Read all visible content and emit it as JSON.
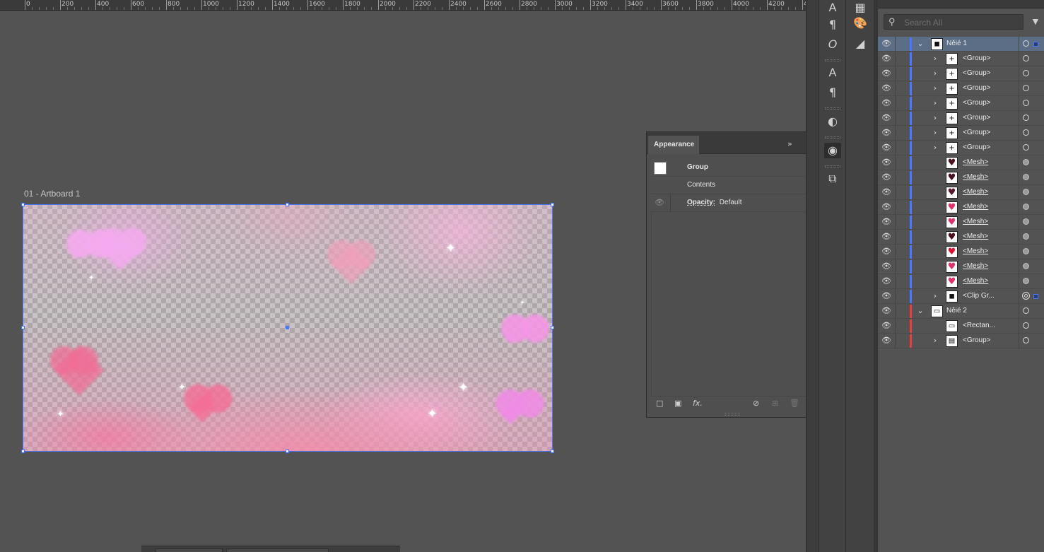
{
  "ruler": {
    "labels": [
      "0",
      "200",
      "400",
      "600",
      "800",
      "1000",
      "1200",
      "1400",
      "1600",
      "1800",
      "2000",
      "2200",
      "2400",
      "2600",
      "2800",
      "3000",
      "3200",
      "3400",
      "3600",
      "3800",
      "4000",
      "4200",
      "4"
    ]
  },
  "canvas": {
    "artboard_label": "01 - Artboard 1"
  },
  "appearance": {
    "tab_label": "Appearance",
    "collapse_glyph": "»",
    "menu_glyph": "≡",
    "rows": {
      "type_label": "Group",
      "contents_label": "Contents",
      "opacity_label": "Opacity:",
      "opacity_value": "Default"
    },
    "footer": {
      "new_stroke": "□",
      "new_fill": "▣",
      "fx": "fx.",
      "clear": "⊘",
      "duplicate": "⊞",
      "delete": "🗑"
    }
  },
  "layers": {
    "search_placeholder": "Search All",
    "rows": [
      {
        "name": "Něié 1",
        "level": 0,
        "expanded": true,
        "thumb": "◼",
        "color": "#4a78ff",
        "selected": true,
        "target": "empty",
        "selsq": true
      },
      {
        "name": "<Group>",
        "level": 1,
        "expandable": true,
        "thumb": "+",
        "color": "#4a78ff",
        "target": "empty"
      },
      {
        "name": "<Group>",
        "level": 1,
        "expandable": true,
        "thumb": "+",
        "color": "#4a78ff",
        "target": "empty"
      },
      {
        "name": "<Group>",
        "level": 1,
        "expandable": true,
        "thumb": "+",
        "color": "#4a78ff",
        "target": "empty"
      },
      {
        "name": "<Group>",
        "level": 1,
        "expandable": true,
        "thumb": "+",
        "color": "#4a78ff",
        "target": "empty"
      },
      {
        "name": "<Group>",
        "level": 1,
        "expandable": true,
        "thumb": "+",
        "color": "#4a78ff",
        "target": "empty"
      },
      {
        "name": "<Group>",
        "level": 1,
        "expandable": true,
        "thumb": "+",
        "color": "#4a78ff",
        "target": "empty"
      },
      {
        "name": "<Group>",
        "level": 1,
        "expandable": true,
        "thumb": "+",
        "color": "#4a78ff",
        "target": "empty"
      },
      {
        "name": "<Mesh>",
        "level": 1,
        "mesh": true,
        "thumb": "♥",
        "thumbColor": "#4a1020",
        "color": "#4a78ff",
        "target": "filled"
      },
      {
        "name": "<Mesh>",
        "level": 1,
        "mesh": true,
        "thumb": "♥",
        "thumbColor": "#4a1020",
        "color": "#4a78ff",
        "target": "filled"
      },
      {
        "name": "<Mesh>",
        "level": 1,
        "mesh": true,
        "thumb": "♥",
        "thumbColor": "#5a1530",
        "color": "#4a78ff",
        "target": "filled"
      },
      {
        "name": "<Mesh>",
        "level": 1,
        "mesh": true,
        "thumb": "♥",
        "thumbColor": "#e0306a",
        "color": "#4a78ff",
        "target": "filled"
      },
      {
        "name": "<Mesh>",
        "level": 1,
        "mesh": true,
        "thumb": "♥",
        "thumbColor": "#e0306a",
        "color": "#4a78ff",
        "target": "filled"
      },
      {
        "name": "<Mesh>",
        "level": 1,
        "mesh": true,
        "thumb": "♥",
        "thumbColor": "#4a1020",
        "color": "#4a78ff",
        "target": "filled"
      },
      {
        "name": "<Mesh>",
        "level": 1,
        "mesh": true,
        "thumb": "♥",
        "thumbColor": "#e01030",
        "color": "#4a78ff",
        "target": "filled"
      },
      {
        "name": "<Mesh>",
        "level": 1,
        "mesh": true,
        "thumb": "♥",
        "thumbColor": "#e0306a",
        "color": "#4a78ff",
        "target": "filled"
      },
      {
        "name": "<Mesh>",
        "level": 1,
        "mesh": true,
        "thumb": "♥",
        "thumbColor": "#e0306a",
        "color": "#4a78ff",
        "target": "filled"
      },
      {
        "name": "<Clip Gr...",
        "level": 1,
        "expandable": true,
        "thumb": "◼",
        "color": "#4a78ff",
        "target": "double",
        "selsq": true
      },
      {
        "name": "Něié 2",
        "level": 0,
        "expanded": true,
        "thumb": "▭",
        "color": "#e84040",
        "target": "empty"
      },
      {
        "name": "<Rectan...",
        "level": 1,
        "thumb": "▭",
        "color": "#e84040",
        "target": "empty"
      },
      {
        "name": "<Group>",
        "level": 1,
        "expandable": true,
        "thumb": "▤",
        "color": "#e84040",
        "target": "empty"
      }
    ]
  },
  "tool_strip": {
    "icons": [
      "character-icon",
      "paragraph-icon",
      "opentype-icon",
      "character-styles-icon",
      "paragraph-styles-icon",
      "pathfinder-icon",
      "appearance-icon",
      "transform-icon"
    ]
  },
  "colors": {
    "selection": "#4a78ff",
    "layer1": "#4a78ff",
    "layer2": "#e84040"
  }
}
